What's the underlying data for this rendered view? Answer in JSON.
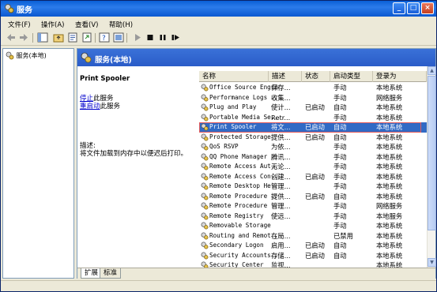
{
  "window": {
    "title": "服务"
  },
  "menu": [
    "文件(F)",
    "操作(A)",
    "查看(V)",
    "帮助(H)"
  ],
  "tree": {
    "root_label": "服务(本地)"
  },
  "header": {
    "title": "服务(本地)"
  },
  "desc": {
    "service_name": "Print Spooler",
    "stop_link": "停止",
    "stop_rest": "此服务",
    "restart_link": "重启动",
    "restart_rest": "此服务",
    "desc_label": "描述:",
    "desc_text": "将文件加载到内存中以便迟后打印。"
  },
  "columns": [
    "名称",
    "描述",
    "状态",
    "启动类型",
    "登录为"
  ],
  "rows": [
    {
      "name": "Office Source Engine",
      "desc": "保存...",
      "status": "",
      "startup": "手动",
      "logon": "本地系统"
    },
    {
      "name": "Performance Logs ...",
      "desc": "收集...",
      "status": "",
      "startup": "手动",
      "logon": "网络服务"
    },
    {
      "name": "Plug and Play",
      "desc": "使计...",
      "status": "已启动",
      "startup": "自动",
      "logon": "本地系统"
    },
    {
      "name": "Portable Media Se...",
      "desc": "Retr...",
      "status": "",
      "startup": "手动",
      "logon": "本地系统"
    },
    {
      "name": "Print Spooler",
      "desc": "将文...",
      "status": "已启动",
      "startup": "自动",
      "logon": "本地系统"
    },
    {
      "name": "Protected Storage",
      "desc": "提供...",
      "status": "已启动",
      "startup": "自动",
      "logon": "本地系统"
    },
    {
      "name": "QoS RSVP",
      "desc": "为依...",
      "status": "",
      "startup": "手动",
      "logon": "本地系统"
    },
    {
      "name": "QQ Phone Manager ...",
      "desc": "腾讯...",
      "status": "",
      "startup": "手动",
      "logon": "本地系统"
    },
    {
      "name": "Remote Access Aut...",
      "desc": "无论...",
      "status": "",
      "startup": "手动",
      "logon": "本地系统"
    },
    {
      "name": "Remote Access Con...",
      "desc": "创建...",
      "status": "已启动",
      "startup": "手动",
      "logon": "本地系统"
    },
    {
      "name": "Remote Desktop He...",
      "desc": "管理...",
      "status": "",
      "startup": "手动",
      "logon": "本地系统"
    },
    {
      "name": "Remote Procedure ...",
      "desc": "提供...",
      "status": "已启动",
      "startup": "自动",
      "logon": "本地系统"
    },
    {
      "name": "Remote Procedure ...",
      "desc": "管理...",
      "status": "",
      "startup": "手动",
      "logon": "网络服务"
    },
    {
      "name": "Remote Registry",
      "desc": "使远...",
      "status": "",
      "startup": "手动",
      "logon": "本地服务"
    },
    {
      "name": "Removable Storage",
      "desc": "",
      "status": "",
      "startup": "手动",
      "logon": "本地系统"
    },
    {
      "name": "Routing and Remot...",
      "desc": "在局...",
      "status": "",
      "startup": "已禁用",
      "logon": "本地系统"
    },
    {
      "name": "Secondary Logon",
      "desc": "启用...",
      "status": "已启动",
      "startup": "自动",
      "logon": "本地系统"
    },
    {
      "name": "Security Accounts...",
      "desc": "存储...",
      "status": "已启动",
      "startup": "自动",
      "logon": "本地系统"
    },
    {
      "name": "Security Center",
      "desc": "监视...",
      "status": "",
      "startup": "",
      "logon": "本地系统"
    }
  ],
  "selected_row": 4,
  "tabs": [
    "扩展",
    "标准"
  ],
  "colors": {
    "accent": "#316ac5",
    "titlebar": "#0a5fd6",
    "highlight_outline": "#e35b5b"
  }
}
